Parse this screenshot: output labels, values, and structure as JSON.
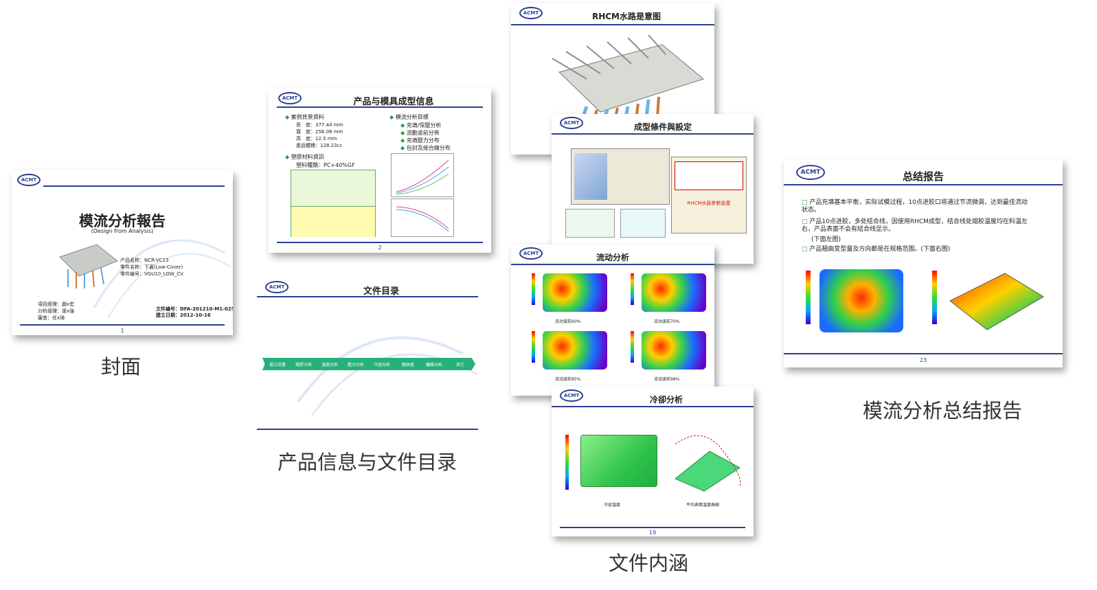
{
  "slides": {
    "cover": {
      "logo": "ACMT",
      "title": "模流分析報告",
      "subtitle": "(Design from Analysis)",
      "product_name": "产品名称：NCR-VC13",
      "part_name": "零件名称：下蓋(Low-Cover)",
      "part_no": "零件编号：VGU10_LOW_CV",
      "project_lead": "項目經理：趙x宏",
      "analyst": "分析經理：張x強",
      "reviewer": "審查：任x琦",
      "doc_no": "文件编号：DFA-201210-M1-025",
      "date": "建立日期：2012-10-16",
      "page": "1"
    },
    "product_info": {
      "logo": "ACMT",
      "title": "产品与模具成型信息",
      "section1": "案例背景資料",
      "length": "長　度：377.44 mm",
      "width": "寬　度：256.08 mm",
      "height": "高　度：12.5 mm",
      "volume": "產品體積：128.23cc",
      "section2": "塑膠材料資訊",
      "material": "塑料種類：PC+40%GF",
      "section3": "模流分析目標",
      "goal1": "充填/保壓分析",
      "goal2": "流動波前分佈",
      "goal3": "充填壓力分布",
      "goal4": "包封及接合線分布",
      "page": "2"
    },
    "toc": {
      "logo": "ACMT",
      "title": "文件目录",
      "steps": [
        "進口流量",
        "熔膠分佈",
        "溫度分析",
        "壓力分析",
        "冷卻分析",
        "翹曲值",
        "纖維分析",
        "其它"
      ]
    },
    "rhcm": {
      "logo": "ACMT",
      "title": "RHCM水路是意图"
    },
    "conditions": {
      "logo": "ACMT",
      "title": "成型條件與設定",
      "note": "RHCM水路參數設置"
    },
    "flow": {
      "logo": "ACMT",
      "title": "流动分析",
      "labels": [
        "流动波前60%",
        "流动波前70%",
        "流动波前85%",
        "流动波前98%"
      ]
    },
    "cooling": {
      "logo": "ACMT",
      "title": "冷卻分析",
      "label_left": "冷卻溫度",
      "label_right": "平均表面溫度曲線",
      "page": "19"
    },
    "summary": {
      "logo": "ACMT",
      "title": "总结报告",
      "point1": "产品充填基本平衡，实际试模过程，10点进胶口将通过节流微调，达到最佳流动状态。",
      "point2": "产品10点进胶，多处结合线，因使用RHCM成型，结合线处熔胶温度均在料温左右，产品表面不会有結合线显示。",
      "point2b": "(下面左图)",
      "point3": "产品翘曲变型量及方向都是在规格范围。(下面右图)",
      "page": "23"
    }
  },
  "captions": {
    "cover": "封面",
    "info": "产品信息与文件目录",
    "content": "文件内涵",
    "summary": "模流分析总结报告"
  },
  "colors": {
    "accent_blue": "#2b3f8f",
    "flow_green": "#26b07a",
    "bullet_green": "#2a9d3a"
  }
}
